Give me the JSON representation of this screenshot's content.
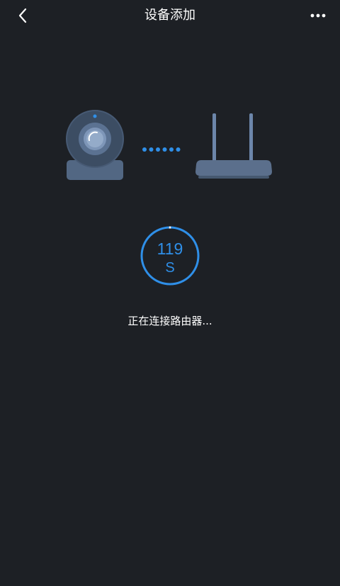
{
  "header": {
    "title": "设备添加",
    "back_icon": "chevron-left-icon",
    "more_icon": "more-horizontal-icon"
  },
  "illustration": {
    "camera_icon": "camera-icon",
    "connection_icon": "dotted-connection-icon",
    "router_icon": "router-icon"
  },
  "countdown": {
    "value": "119",
    "unit": "S",
    "accent_color": "#2f8fe8"
  },
  "status_text": "正在连接路由器...",
  "colors": {
    "background": "#1d2025",
    "accent": "#2f8fe8",
    "device_fill": "#5b6f8c"
  }
}
